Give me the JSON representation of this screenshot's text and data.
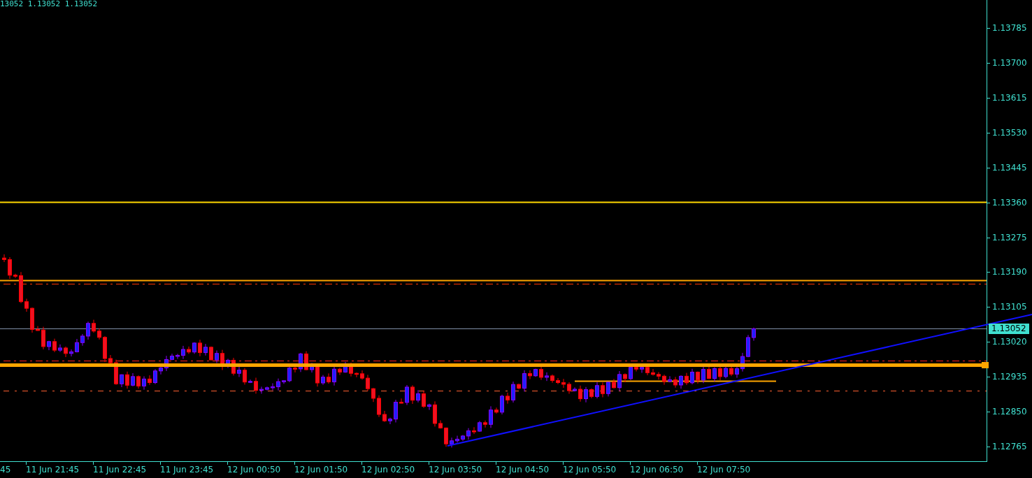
{
  "header": {
    "text": "13052 1.13052 1.13052"
  },
  "price_axis": {
    "labels": [
      "1.13785",
      "1.13700",
      "1.13615",
      "1.13530",
      "1.13445",
      "1.13360",
      "1.13275",
      "1.13190",
      "1.13105",
      "1.13020",
      "1.12935",
      "1.12850",
      "1.12765"
    ],
    "current_price": "1.13052"
  },
  "time_axis": {
    "labels": [
      "45",
      "11 Jun 21:45",
      "11 Jun 22:45",
      "11 Jun 23:45",
      "12 Jun 00:50",
      "12 Jun 01:50",
      "12 Jun 02:50",
      "12 Jun 03:50",
      "12 Jun 04:50",
      "12 Jun 05:50",
      "12 Jun 06:50",
      "12 Jun 07:50"
    ]
  }
}
